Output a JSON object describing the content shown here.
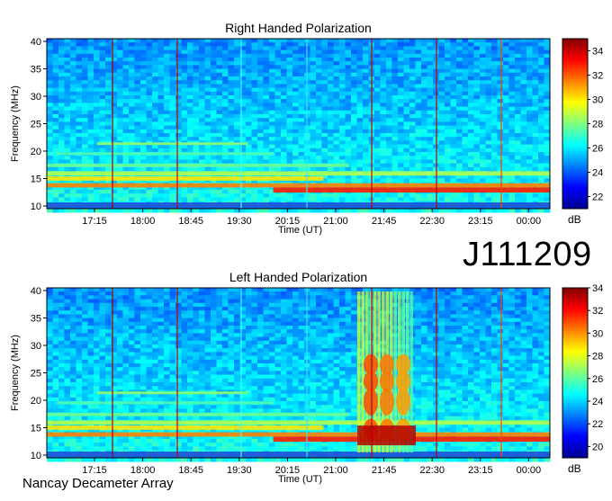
{
  "observation_id": "J111209",
  "footer": "Nancay Decameter Array",
  "chart_data": [
    {
      "type": "heatmap",
      "title": "Right Handed Polarization",
      "xlabel": "Time (UT)",
      "ylabel": "Frequency (MHz)",
      "xticks": [
        "17:15",
        "18:00",
        "18:45",
        "19:30",
        "20:15",
        "21:00",
        "21:45",
        "22:30",
        "23:15",
        "00:00"
      ],
      "yticks": [
        10,
        15,
        20,
        25,
        30,
        35,
        40
      ],
      "ylim": [
        10,
        40
      ],
      "colorbar": {
        "label": "dB",
        "ticks": [
          22,
          24,
          26,
          28,
          30,
          32,
          34
        ],
        "range": [
          21,
          35
        ]
      }
    },
    {
      "type": "heatmap",
      "title": "Left Handed Polarization",
      "xlabel": "Time (UT)",
      "ylabel": "Frequency (MHz)",
      "xticks": [
        "17:15",
        "18:00",
        "18:45",
        "19:30",
        "20:15",
        "21:00",
        "21:45",
        "22:30",
        "23:15",
        "00:00"
      ],
      "yticks": [
        10,
        15,
        20,
        25,
        30,
        35,
        40
      ],
      "ylim": [
        10,
        40
      ],
      "colorbar": {
        "label": "dB",
        "ticks": [
          20,
          22,
          24,
          26,
          28,
          30,
          32,
          34
        ],
        "range": [
          19,
          34
        ]
      }
    }
  ]
}
